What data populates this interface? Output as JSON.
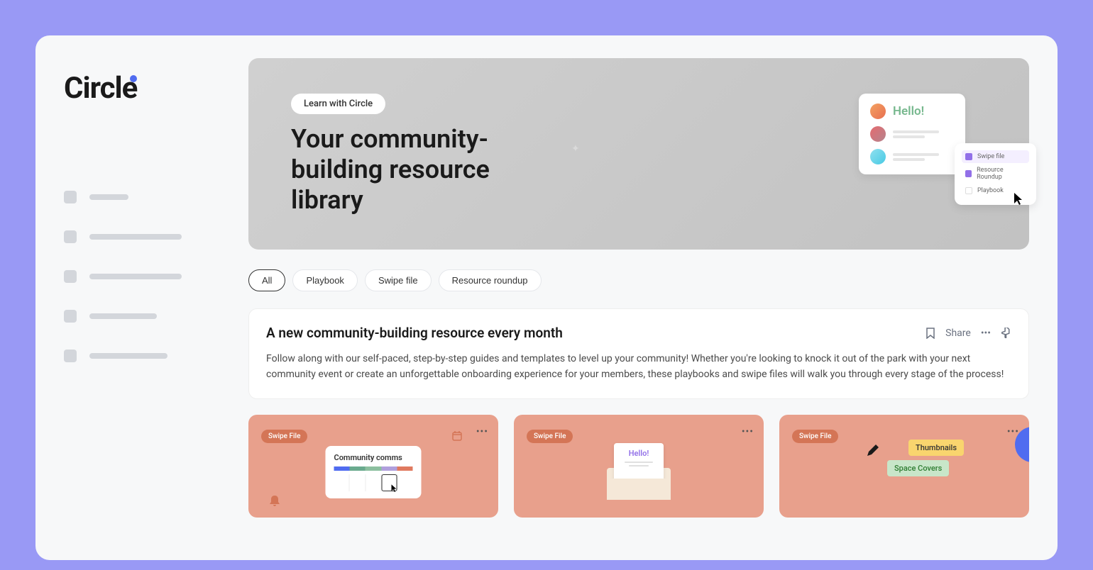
{
  "brand": {
    "name": "Circle"
  },
  "hero": {
    "badge": "Learn with Circle",
    "title": "Your community-building resource library",
    "chat_greeting": "Hello!",
    "dropdown": {
      "item1": "Swipe file",
      "item2": "Resource Roundup",
      "item3": "Playbook"
    }
  },
  "filters": {
    "all": "All",
    "playbook": "Playbook",
    "swipe_file": "Swipe file",
    "resource_roundup": "Resource roundup"
  },
  "section": {
    "title": "A new community-building resource every month",
    "description": "Follow along with our self-paced, step-by-step guides and templates to level up your community! Whether you're looking to knock it out of the park with your next community event or create an unforgettable onboarding experience for your members, these playbooks and swipe files will walk you through every stage of the process!",
    "share_label": "Share"
  },
  "cards": {
    "badge": "Swipe File",
    "card1": {
      "graphic_title": "Community comms"
    },
    "card2": {
      "graphic_title": "Hello!"
    },
    "card3": {
      "label1": "Thumbnails",
      "label2": "Space Covers"
    }
  }
}
